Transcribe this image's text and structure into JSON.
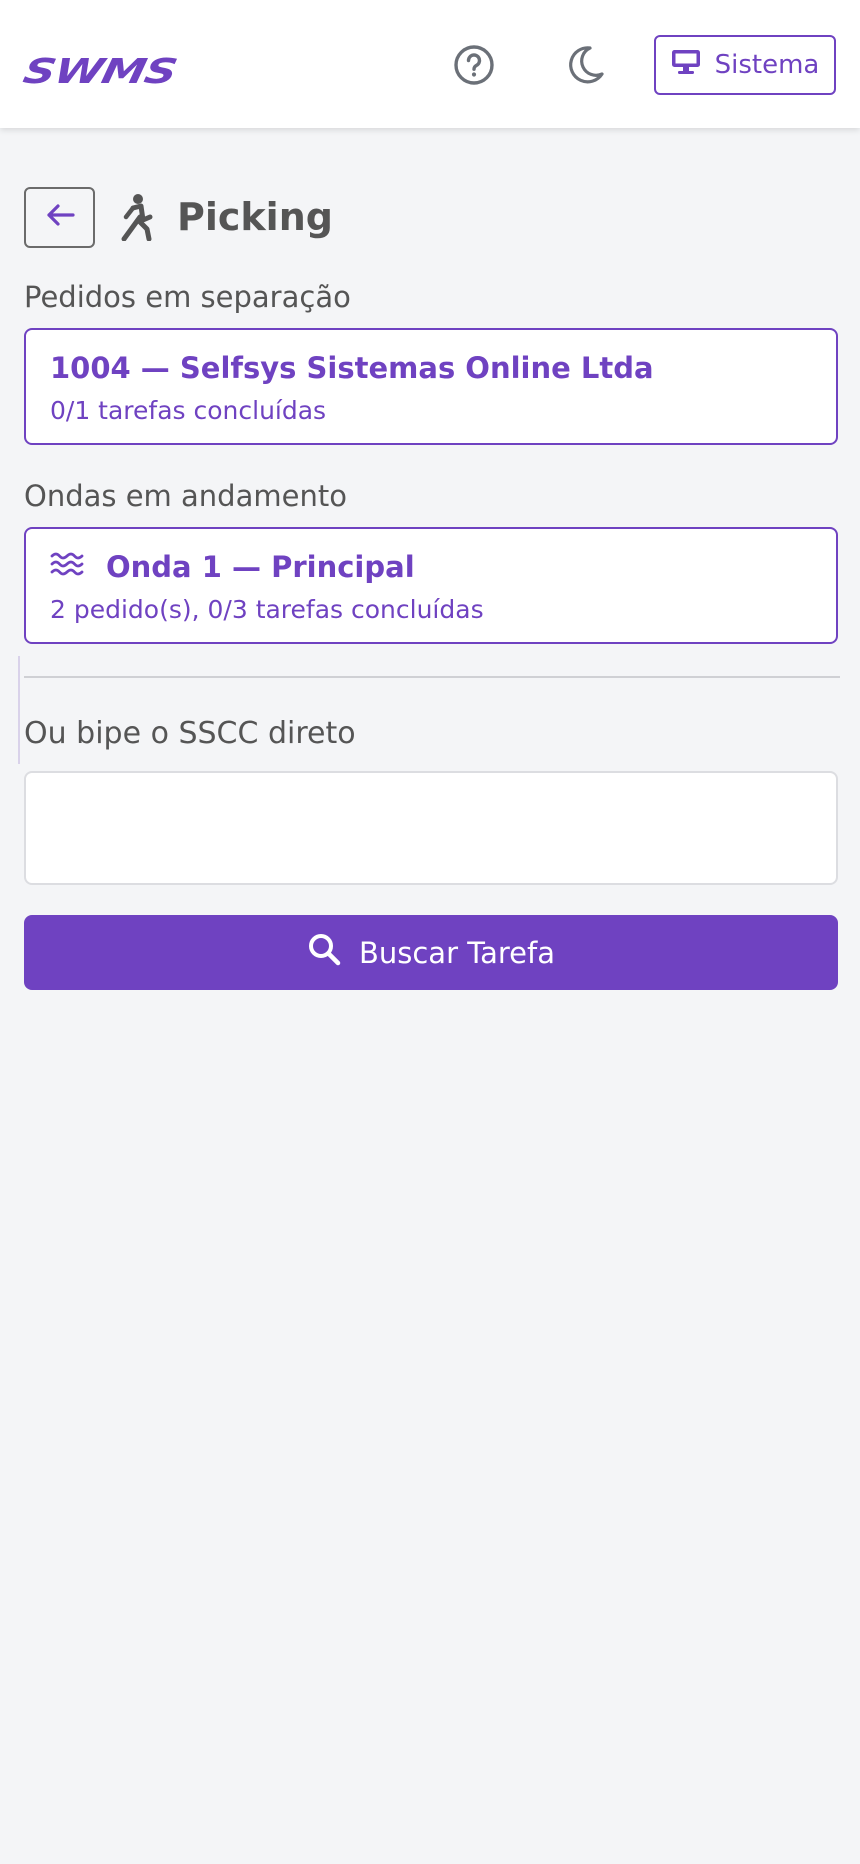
{
  "header": {
    "logo": "SWMS",
    "system_label": "Sistema"
  },
  "page": {
    "title": "Picking"
  },
  "orders_section": {
    "label": "Pedidos em separação",
    "items": [
      {
        "title": "1004 — Selfsys Sistemas Online Ltda",
        "subtitle": "0/1 tarefas concluídas"
      }
    ]
  },
  "waves_section": {
    "label": "Ondas em andamento",
    "items": [
      {
        "title": "Onda 1 — Principal",
        "subtitle": "2 pedido(s), 0/3 tarefas concluídas"
      }
    ]
  },
  "sscc": {
    "label": "Ou bipe o SSCC direto",
    "value": "",
    "placeholder": ""
  },
  "search_button": {
    "label": "Buscar Tarefa"
  },
  "colors": {
    "accent": "#6f42c1",
    "text": "#555555",
    "background": "#f4f5f7"
  }
}
